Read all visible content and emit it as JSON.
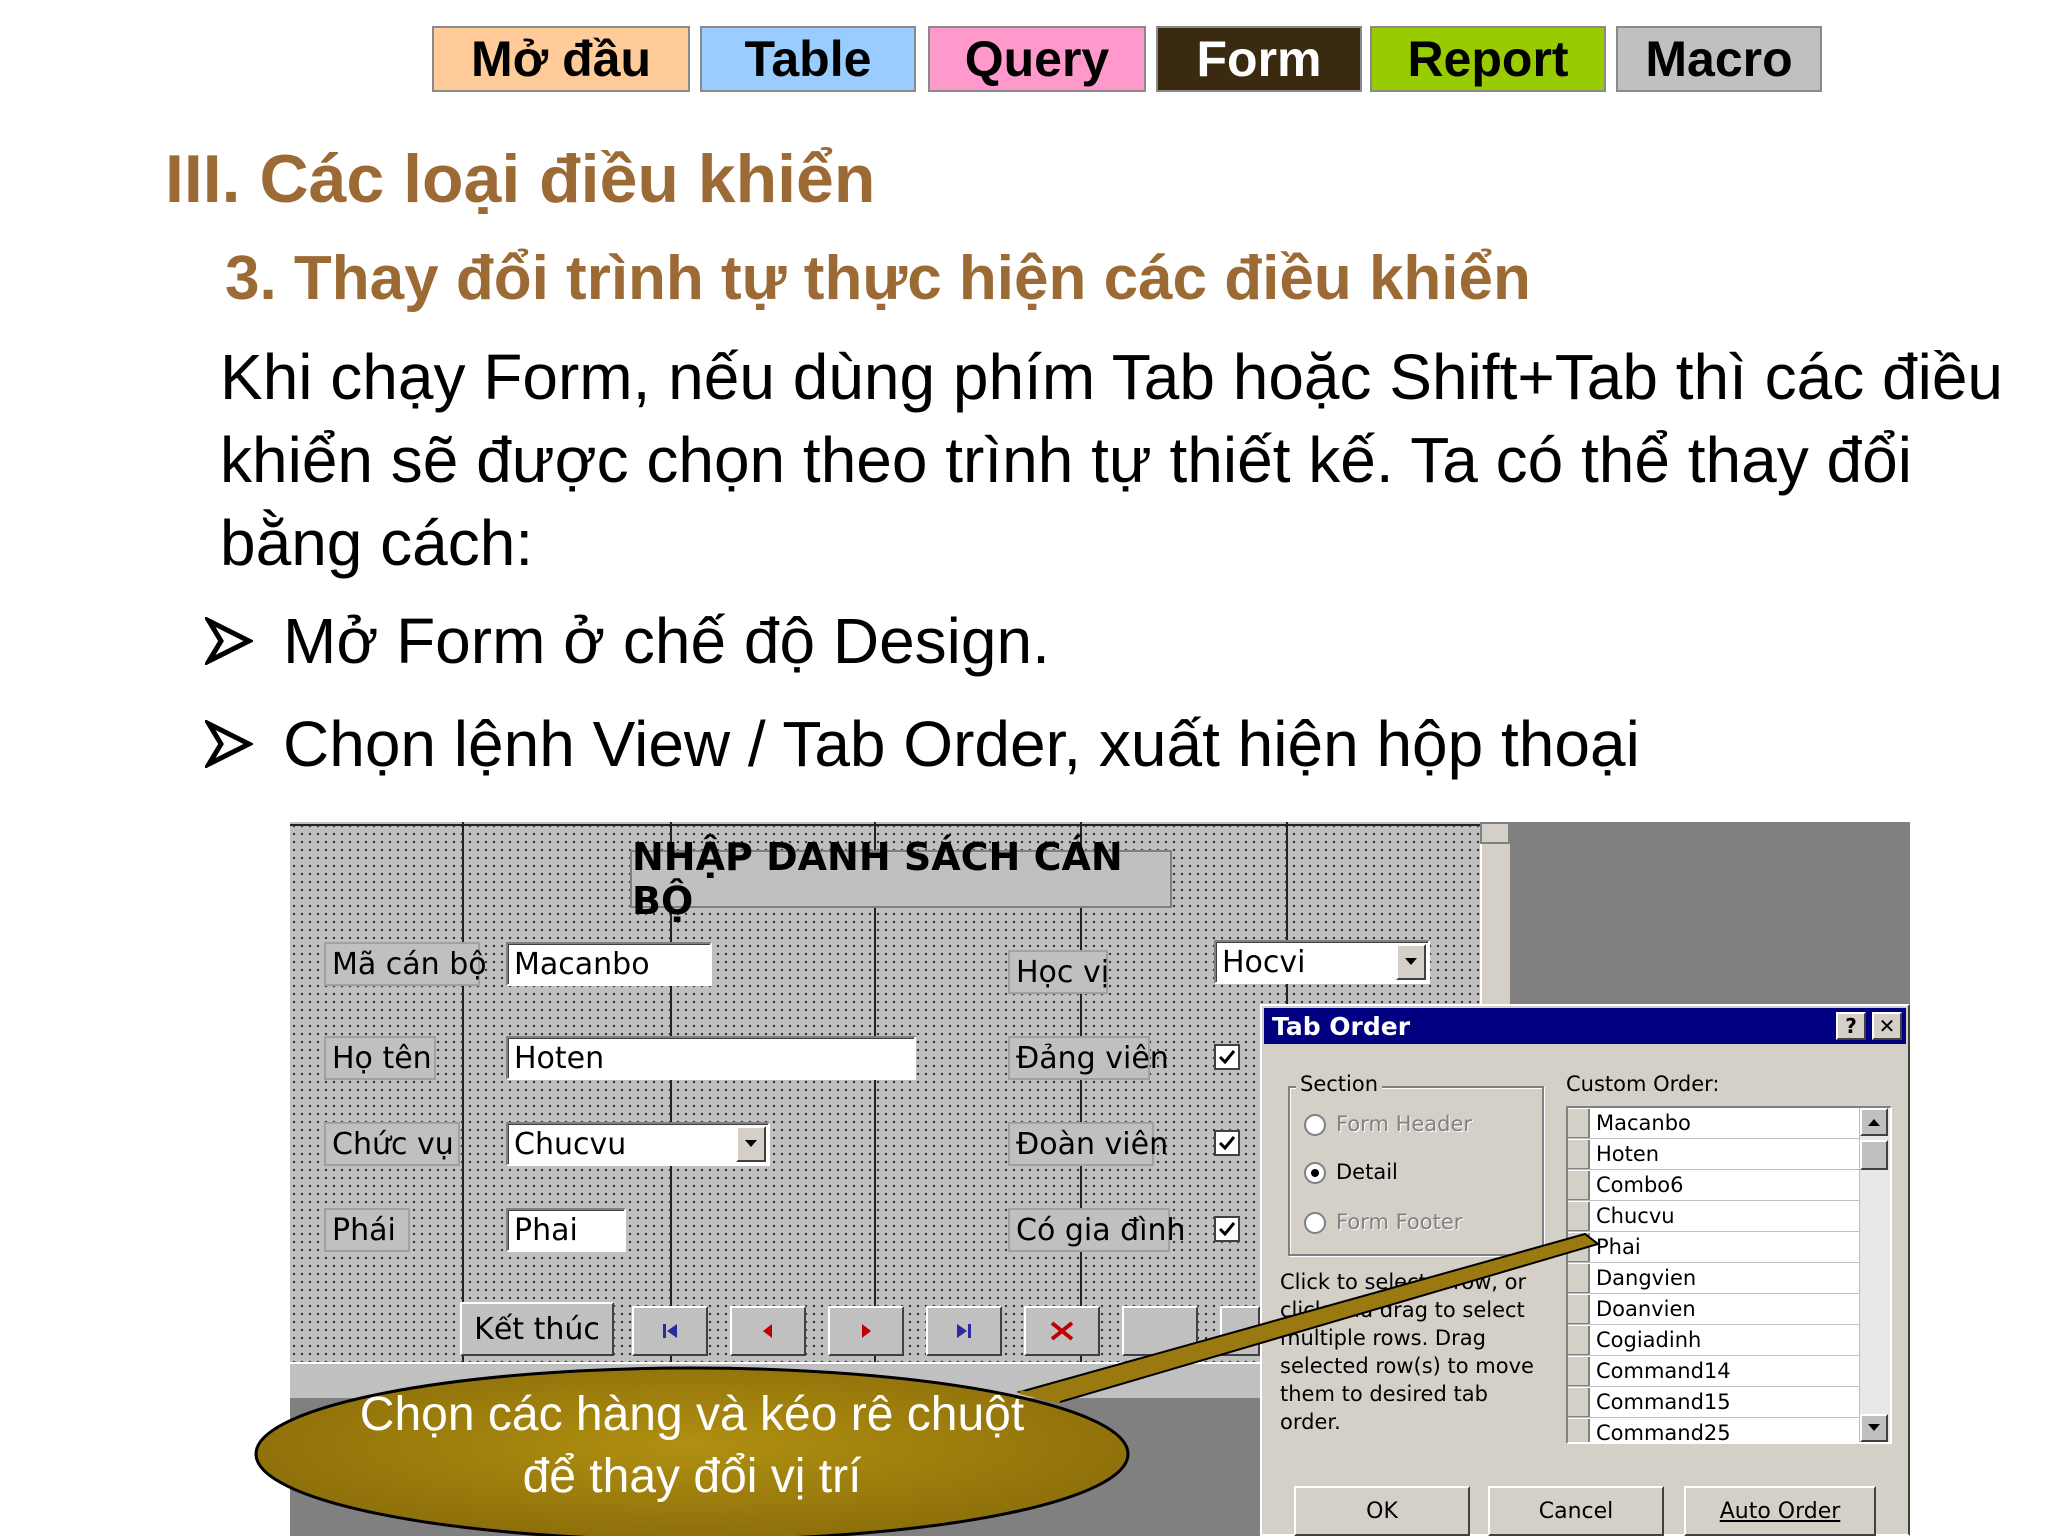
{
  "nav": {
    "items": [
      {
        "label": "Mở đầu",
        "bg": "#ffcc99",
        "fg": "#000000"
      },
      {
        "label": "Table",
        "bg": "#99ccff",
        "fg": "#000000"
      },
      {
        "label": "Query",
        "bg": "#ff99cc",
        "fg": "#000000"
      },
      {
        "label": "Form",
        "bg": "#3a2a10",
        "fg": "#ffffff"
      },
      {
        "label": "Report",
        "bg": "#99cc00",
        "fg": "#000000"
      },
      {
        "label": "Macro",
        "bg": "#c0c0c0",
        "fg": "#000000"
      }
    ]
  },
  "slide": {
    "heading": "III. Các loại điều khiển",
    "subheading": "3. Thay đổi trình tự thực hiện các điều khiển",
    "paragraph": " Khi chạy Form, nếu dùng phím Tab hoặc Shift+Tab thì các điều khiển sẽ được chọn theo trình tự thiết kế. Ta có thể thay đổi bằng cách:",
    "bullets": [
      "Mở Form ở chế độ Design.",
      "Chọn lệnh View / Tab Order, xuất hiện hộp thoại"
    ],
    "accent_color": "#9c6a34"
  },
  "form": {
    "title": "NHẬP DANH SÁCH CÁN BỘ",
    "labels": {
      "macanbo": "Mã cán bộ",
      "hoten": "Họ tên",
      "chucvu": "Chức vụ",
      "phai": "Phái",
      "hocvi": "Học vị",
      "dangvien": "Đảng viên",
      "doanvien": "Đoàn viên",
      "cogiadinh": "Có gia đình"
    },
    "fields": {
      "macanbo": "Macanbo",
      "hoten": "Hoten",
      "chucvu": "Chucvu",
      "phai": "Phai",
      "hocvi": "Hocvi"
    },
    "checkboxes": {
      "dangvien": true,
      "doanvien": true,
      "cogiadinh": true
    },
    "exit_button": "Kết thúc",
    "nav_icons": [
      "first-record-icon",
      "previous-record-icon",
      "next-record-icon",
      "last-record-icon",
      "delete-record-icon"
    ]
  },
  "dialog": {
    "title": "Tab Order",
    "help_label": "?",
    "close_label": "✕",
    "section_label": "Section",
    "sections": [
      {
        "label": "Form Header",
        "selected": false,
        "enabled": false
      },
      {
        "label": "Detail",
        "selected": true,
        "enabled": true
      },
      {
        "label": "Form Footer",
        "selected": false,
        "enabled": false
      }
    ],
    "help_text": "Click to select a row, or click and drag to select multiple rows. Drag selected row(s) to move them to desired tab order.",
    "custom_order_label": "Custom Order:",
    "custom_order": [
      "Macanbo",
      "Hoten",
      "Combo6",
      "Chucvu",
      "Phai",
      "Dangvien",
      "Doanvien",
      "Cogiadinh",
      "Command14",
      "Command15",
      "Command25"
    ],
    "buttons": {
      "ok": "OK",
      "cancel": "Cancel",
      "auto_order": "Auto Order"
    }
  },
  "callout": {
    "text": "Chọn các hàng và kéo rê chuột để thay đổi vị trí",
    "fill": "#9a7a10"
  }
}
